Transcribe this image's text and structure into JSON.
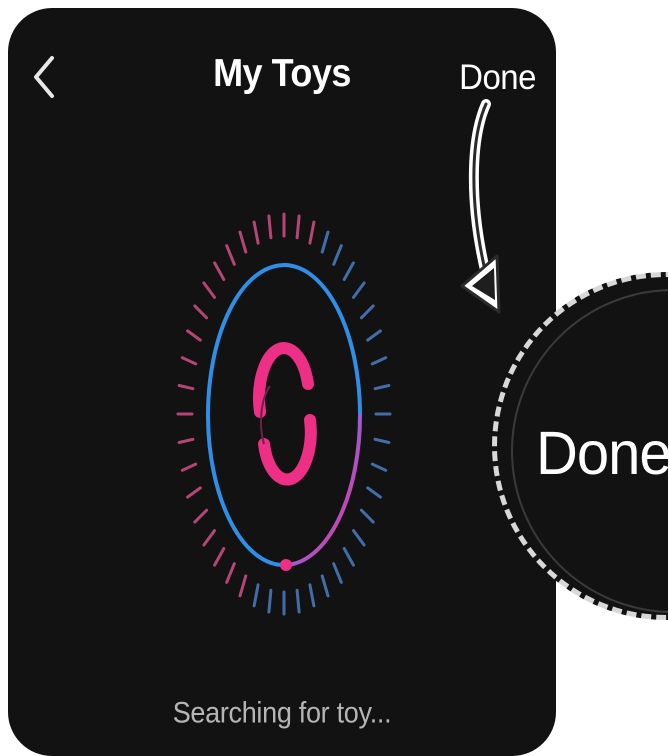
{
  "header": {
    "back_icon": "chevron-left-icon",
    "title": "My Toys",
    "done_label": "Done"
  },
  "scanner": {
    "center_icon": "refresh-spinner-icon",
    "colors": {
      "ring_blue": "#2f8fe6",
      "ring_purple": "#9b5cd6",
      "ring_pink": "#ee2f86",
      "tick_pink": "#d24f88",
      "tick_blue": "#4a7fc4"
    }
  },
  "status": {
    "text": "Searching for toy..."
  },
  "callout": {
    "label": "Done",
    "arrow_icon": "pointer-arrow-icon"
  }
}
